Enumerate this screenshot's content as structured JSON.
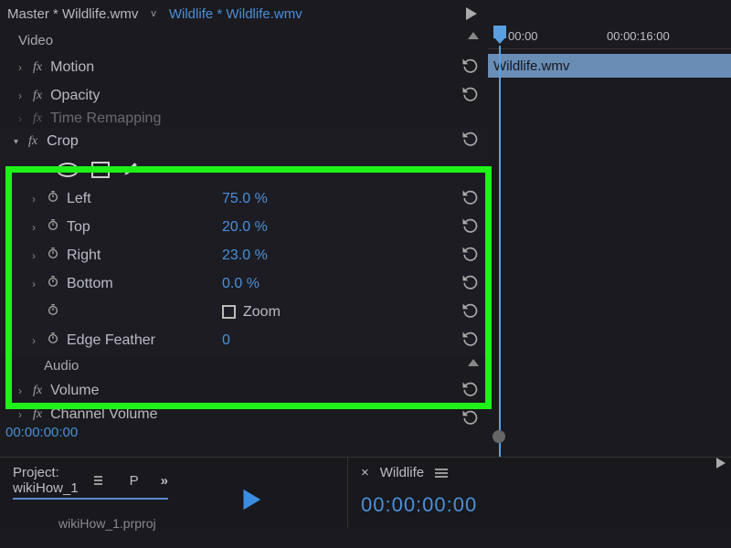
{
  "tabs": {
    "master": "Master * Wildlife.wmv",
    "clip": "Wildlife * Wildlife.wmv"
  },
  "sections": {
    "video": "Video",
    "audio": "Audio"
  },
  "effects": {
    "motion": "Motion",
    "opacity": "Opacity",
    "time_remapping": "Time Remapping",
    "volume": "Volume",
    "channel_volume": "Channel Volume"
  },
  "crop": {
    "name": "Crop",
    "zoom_label": "Zoom",
    "zoom_checked": false,
    "props": [
      {
        "label": "Left",
        "value": "75.0 %"
      },
      {
        "label": "Top",
        "value": "20.0 %"
      },
      {
        "label": "Right",
        "value": "23.0 %"
      },
      {
        "label": "Bottom",
        "value": "0.0 %"
      },
      {
        "label": "Edge Feather",
        "value": "0"
      }
    ]
  },
  "timecode": {
    "left": "00:00:00:00"
  },
  "timeline": {
    "marks": [
      "00:00",
      "00:00:16:00"
    ],
    "clip": "Wildlife.wmv"
  },
  "project": {
    "tab": "Project: wikiHow_1",
    "short": "P",
    "item": "wikiHow_1.prproj"
  },
  "source": {
    "tab": "Wildlife",
    "timecode": "00:00:00:00"
  },
  "highlight_color": "#1ef219",
  "accent_color": "#4a90d9"
}
